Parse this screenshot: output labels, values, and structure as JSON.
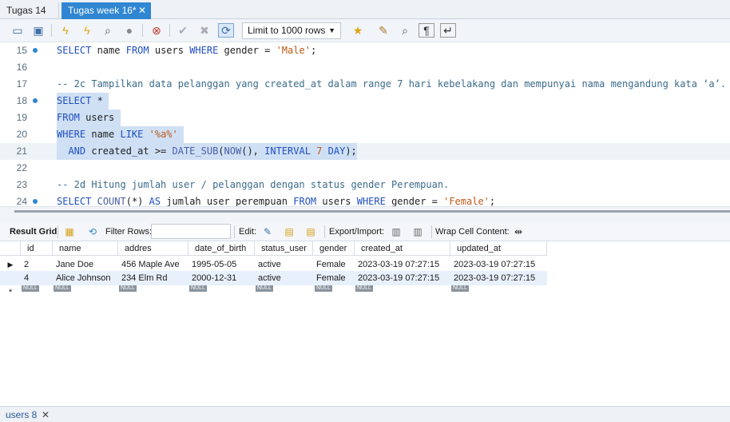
{
  "tabs": [
    {
      "label": "Tugas 14"
    },
    {
      "label": "Tugas week 16*"
    }
  ],
  "toolbar": {
    "limit_label": "Limit to 1000 rows",
    "icons": [
      "open-file-icon",
      "save-icon",
      "execute-icon",
      "execute-current-icon",
      "explain-icon",
      "stop-icon",
      "toggle-error-icon",
      "commit-icon",
      "rollback-icon",
      "autocommit-icon",
      "add-snippet-icon",
      "beautify-icon",
      "find-icon",
      "invisible-chars-icon",
      "wrap-icon"
    ]
  },
  "editor": {
    "lines": [
      {
        "n": "15",
        "dot": true
      },
      {
        "n": "16",
        "dot": false
      },
      {
        "n": "17",
        "dot": false
      },
      {
        "n": "18",
        "dot": true
      },
      {
        "n": "19",
        "dot": false
      },
      {
        "n": "20",
        "dot": false
      },
      {
        "n": "21",
        "dot": false
      },
      {
        "n": "22",
        "dot": false
      },
      {
        "n": "23",
        "dot": false
      },
      {
        "n": "24",
        "dot": true
      }
    ],
    "code": {
      "l15": {
        "a": "SELECT",
        "b": " name ",
        "c": "FROM",
        "d": " users ",
        "e": "WHERE",
        "f": " gender = ",
        "g": "'Male'",
        "h": ";"
      },
      "l17": "-- 2c Tampilkan data pelanggan yang created_at dalam range 7 hari kebelakang dan mempunyai nama mengandung kata ‘a’.",
      "l18": {
        "a": "SELECT",
        "b": " *"
      },
      "l19": {
        "a": "FROM",
        "b": " users"
      },
      "l20": {
        "a": "WHERE",
        "b": " name ",
        "c": "LIKE",
        "d": " ",
        "e": "'%a%'"
      },
      "l21": {
        "a": "  AND",
        "b": " created_at >= ",
        "c": "DATE_SUB",
        "d": "(",
        "e": "NOW",
        "f": "(), ",
        "g": "INTERVAL",
        "h": " ",
        "i": "7",
        "j": " ",
        "k": "DAY",
        "l": ");"
      },
      "l23": "-- 2d Hitung jumlah user / pelanggan dengan status gender Perempuan.",
      "l24": {
        "a": "SELECT",
        "b": " ",
        "c": "COUNT",
        "d": "(*) ",
        "e": "AS",
        "f": " jumlah_user_perempuan ",
        "g": "FROM",
        "h": " users ",
        "i": "WHERE",
        "j": " gender = ",
        "k": "'Female'",
        "l": ";"
      }
    }
  },
  "result_bar": {
    "result_grid": "Result Grid",
    "filter_rows": "Filter Rows:",
    "edit": "Edit:",
    "export_import": "Export/Import:",
    "wrap_cell": "Wrap Cell Content:"
  },
  "grid": {
    "columns": [
      "id",
      "name",
      "addres",
      "date_of_birth",
      "status_user",
      "gender",
      "created_at",
      "updated_at"
    ],
    "rows": [
      [
        "2",
        "Jane Doe",
        "456 Maple Ave",
        "1995-05-05",
        "active",
        "Female",
        "2023-03-19 07:27:15",
        "2023-03-19 07:27:15"
      ],
      [
        "4",
        "Alice Johnson",
        "234 Elm Rd",
        "2000-12-31",
        "active",
        "Female",
        "2023-03-19 07:27:15",
        "2023-03-19 07:27:15"
      ]
    ],
    "null_label": "NULL",
    "new_row_marker": "*"
  },
  "bottom_tab": {
    "label": "users 8",
    "close": "✕"
  }
}
